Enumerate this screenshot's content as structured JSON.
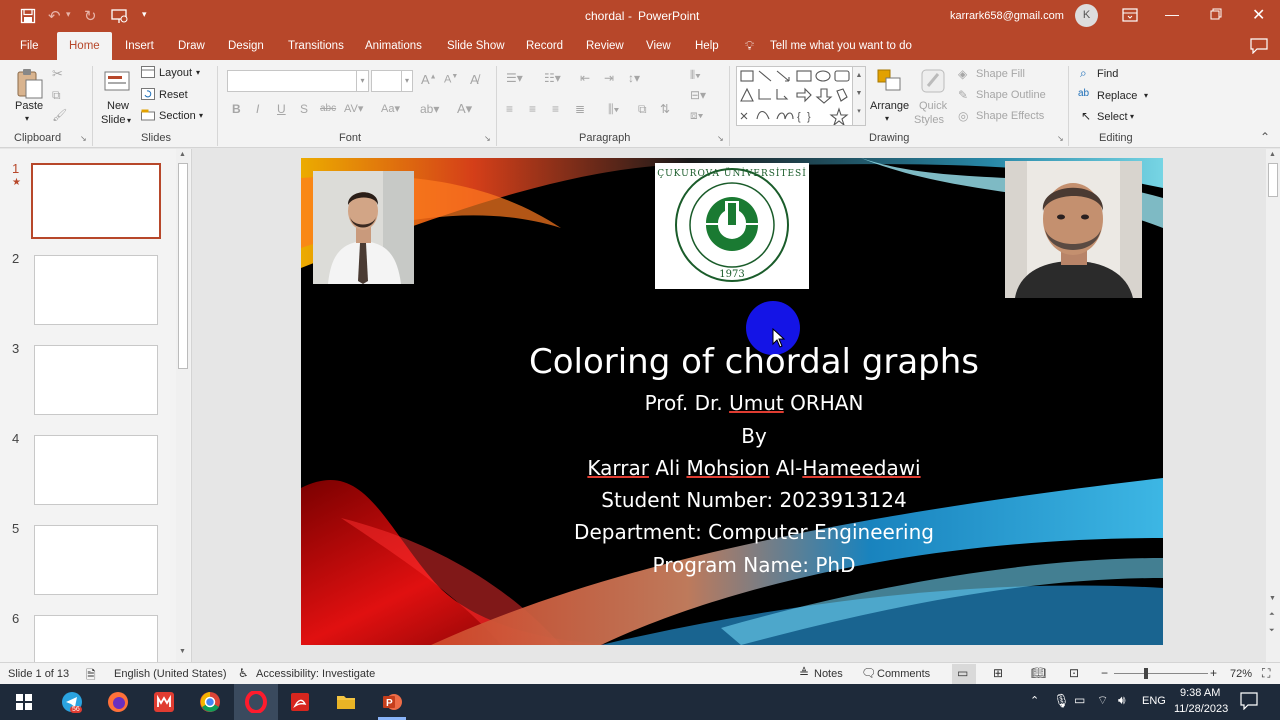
{
  "title_bar": {
    "document_title": "chordal",
    "separator": "-",
    "app_name": "PowerPoint",
    "account_email": "karrark658@gmail.com",
    "account_initial": "K"
  },
  "tabs": [
    {
      "label": "File"
    },
    {
      "label": "Home"
    },
    {
      "label": "Insert"
    },
    {
      "label": "Draw"
    },
    {
      "label": "Design"
    },
    {
      "label": "Transitions"
    },
    {
      "label": "Animations"
    },
    {
      "label": "Slide Show"
    },
    {
      "label": "Record"
    },
    {
      "label": "Review"
    },
    {
      "label": "View"
    },
    {
      "label": "Help"
    }
  ],
  "tell_me": "Tell me what you want to do",
  "ribbon": {
    "clipboard": {
      "paste": "Paste",
      "label": "Clipboard"
    },
    "slides": {
      "new_slide_line1": "New",
      "new_slide_line2": "Slide",
      "layout": "Layout",
      "reset": "Reset",
      "section": "Section",
      "label": "Slides"
    },
    "font": {
      "label": "Font"
    },
    "paragraph": {
      "label": "Paragraph"
    },
    "drawing": {
      "arrange": "Arrange",
      "quick_styles_line1": "Quick",
      "quick_styles_line2": "Styles",
      "shape_fill": "Shape Fill",
      "shape_outline": "Shape Outline",
      "shape_effects": "Shape Effects",
      "label": "Drawing"
    },
    "editing": {
      "find": "Find",
      "replace": "Replace",
      "select": "Select",
      "label": "Editing"
    }
  },
  "thumbnails": [
    {
      "number": "1",
      "star": "★"
    },
    {
      "number": "2"
    },
    {
      "number": "3"
    },
    {
      "number": "4"
    },
    {
      "number": "5"
    },
    {
      "number": "6"
    }
  ],
  "slide": {
    "logo_text": "ÇUKUROVA ÜNİVERSİTESİ",
    "logo_year": "1973",
    "title": "Coloring of chordal graphs",
    "prof_prefix": "Prof. Dr. ",
    "prof_first": "Umut",
    "prof_last": " ORHAN",
    "by": "By",
    "author_first": "Karrar",
    "author_mid1": " Ali ",
    "author_mid2": "Mohsion",
    "author_mid3": " Al-",
    "author_last": "Hameedawi",
    "student_number": "Student Number: 2023913124",
    "department": "Department: Computer Engineering",
    "program": "Program Name: PhD"
  },
  "status_bar": {
    "slide_info": "Slide 1 of 13",
    "language": "English (United States)",
    "accessibility": "Accessibility: Investigate",
    "notes": "Notes",
    "comments": "Comments",
    "zoom": "72%"
  },
  "taskbar": {
    "badge": "56",
    "time": "9:38 AM",
    "date": "11/28/2023",
    "lang": "ENG"
  },
  "colors": {
    "accent": "#b7472a",
    "taskbar": "#1e2a3a"
  }
}
